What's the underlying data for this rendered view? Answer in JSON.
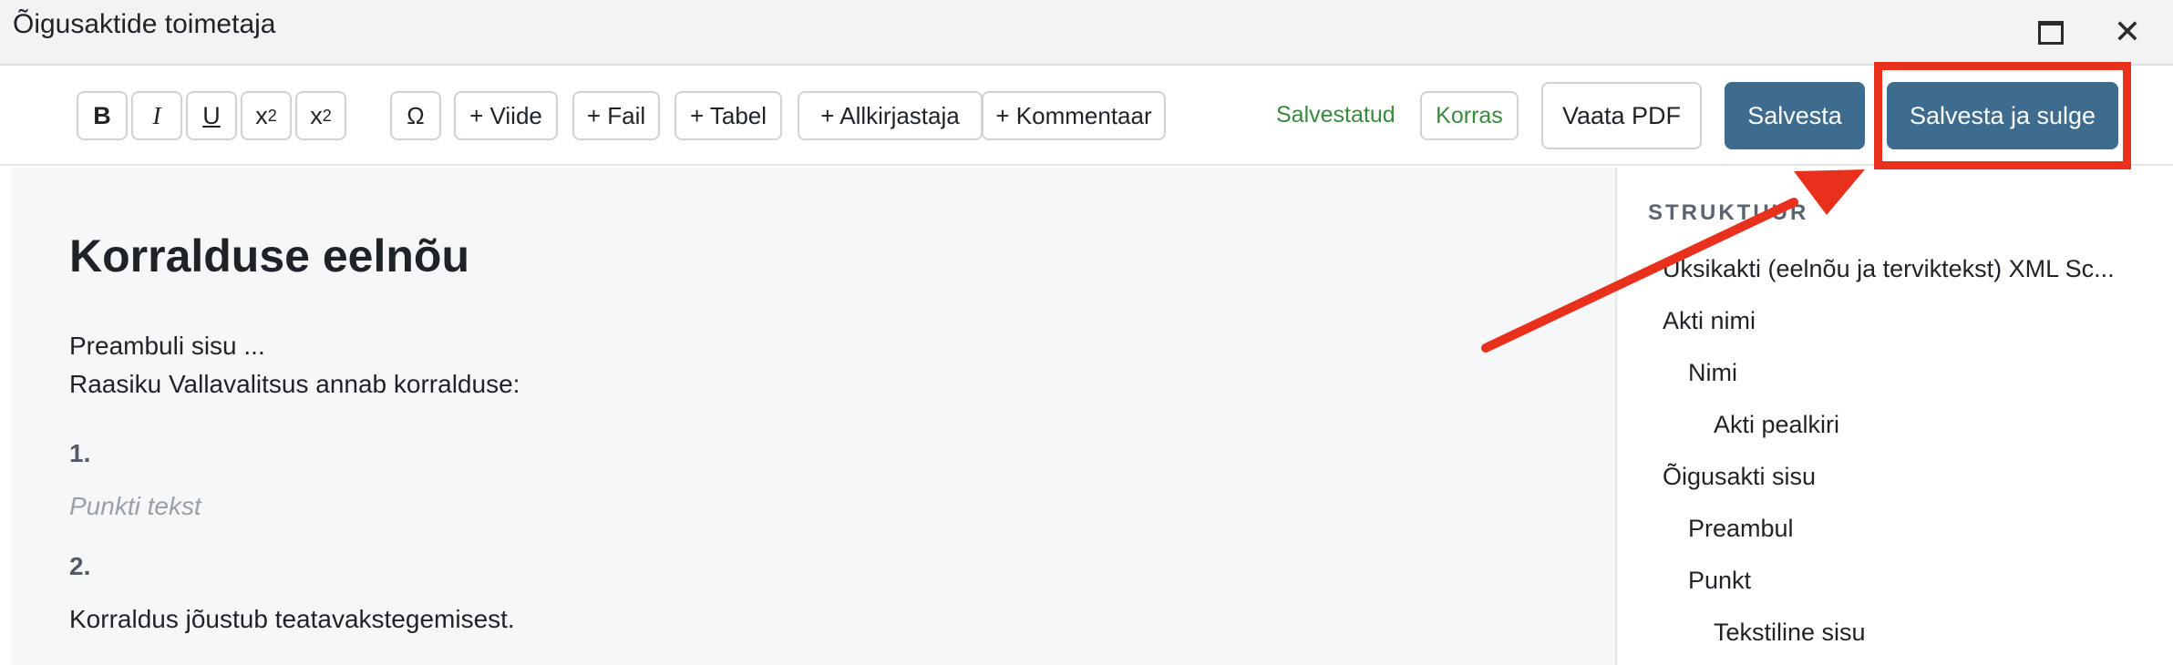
{
  "window": {
    "title": "Õigusaktide toimetaja",
    "maximize_icon": "maximize-icon",
    "close_icon": "close-icon",
    "close_glyph": "✕"
  },
  "toolbar": {
    "format": {
      "bold": "B",
      "italic": "I",
      "underline": "U",
      "superscript_base": "x",
      "superscript_exp": "2",
      "subscript_base": "x",
      "subscript_exp": "2"
    },
    "omega": "Ω",
    "insert_buttons": [
      "+ Viide",
      "+ Fail",
      "+ Tabel",
      "+ Allkirjastaja",
      "+ Kommentaar"
    ],
    "status_text": "Salvestatud",
    "status_badge": "Korras",
    "view_pdf": "Vaata PDF",
    "save": "Salvesta",
    "save_and_close": "Salvesta ja sulge"
  },
  "editor": {
    "heading": "Korralduse eelnõu",
    "preamble": "Preambuli sisu ...",
    "intro": "Raasiku Vallavalitsus annab korralduse:",
    "items": [
      {
        "number": "1.",
        "text": "Punkti tekst",
        "placeholder": true
      },
      {
        "number": "2.",
        "text": "Korraldus jõustub teatavakstegemisest.",
        "placeholder": false
      }
    ]
  },
  "sidebar": {
    "heading": "STRUKTUUR",
    "tree": [
      {
        "label": "Üksikakti (eelnõu ja terviktekst) XML Sc...",
        "level": 0
      },
      {
        "label": "Akti nimi",
        "level": 0
      },
      {
        "label": "Nimi",
        "level": 1
      },
      {
        "label": "Akti pealkiri",
        "level": 2
      },
      {
        "label": "Õigusakti sisu",
        "level": 0
      },
      {
        "label": "Preambul",
        "level": 1
      },
      {
        "label": "Punkt",
        "level": 1
      },
      {
        "label": "Tekstiline sisu",
        "level": 2
      }
    ]
  },
  "colors": {
    "primary": "#3d6c8e",
    "success": "#3a8a3d",
    "annotation": "#e8301c"
  }
}
